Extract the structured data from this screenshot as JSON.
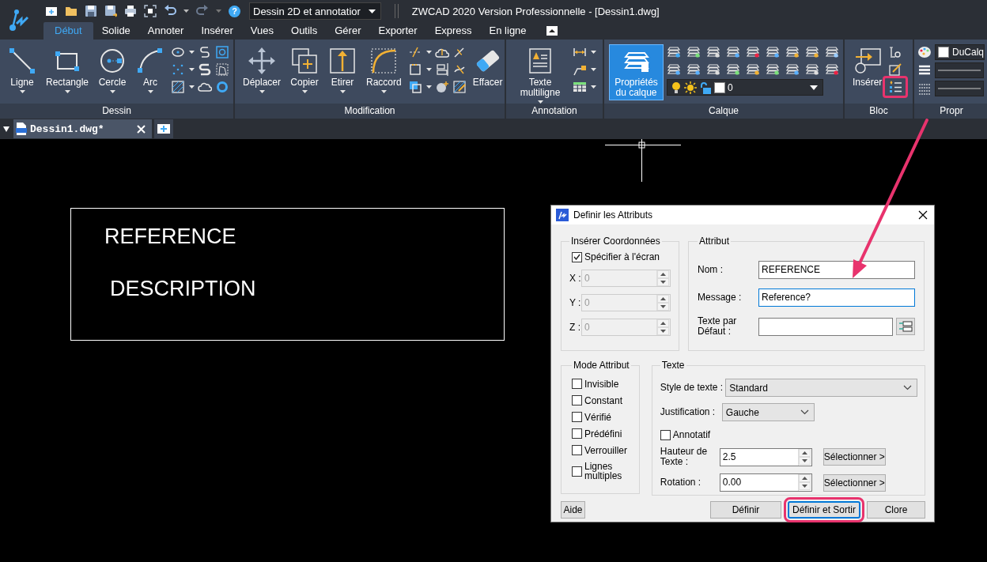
{
  "app": {
    "workspace": "Dessin 2D et annotatior",
    "title": "ZWCAD 2020 Version Professionnelle - [Dessin1.dwg]",
    "help": "?"
  },
  "ribbon_tabs": [
    {
      "label": "Début",
      "selected": true
    },
    {
      "label": "Solide",
      "selected": false
    },
    {
      "label": "Annoter",
      "selected": false
    },
    {
      "label": "Insérer",
      "selected": false
    },
    {
      "label": "Vues",
      "selected": false
    },
    {
      "label": "Outils",
      "selected": false
    },
    {
      "label": "Gérer",
      "selected": false
    },
    {
      "label": "Exporter",
      "selected": false
    },
    {
      "label": "Express",
      "selected": false
    },
    {
      "label": "En ligne",
      "selected": false
    }
  ],
  "ribbon_panels": [
    {
      "title": "Dessin",
      "tools": [
        {
          "label": "Ligne",
          "dropdown": true,
          "active": false
        },
        {
          "label": "Rectangle",
          "dropdown": true,
          "active": false
        },
        {
          "label": "Cercle",
          "dropdown": true,
          "active": false
        },
        {
          "label": "Arc",
          "dropdown": true,
          "active": false
        }
      ]
    },
    {
      "title": "Modification",
      "tools": [
        {
          "label": "Déplacer",
          "dropdown": true,
          "active": false
        },
        {
          "label": "Copier",
          "dropdown": true,
          "active": false
        },
        {
          "label": "Etirer",
          "dropdown": true,
          "active": false
        },
        {
          "label": "Raccord",
          "dropdown": true,
          "active": false
        },
        {
          "label": "Effacer",
          "dropdown": false,
          "active": false
        }
      ]
    },
    {
      "title": "Annotation",
      "tools": [
        {
          "label": "Texte multiligne",
          "dropdown": true,
          "active": false
        }
      ]
    },
    {
      "title": "Calque",
      "tools": [
        {
          "label": "Propriétés du calque",
          "dropdown": false,
          "active": true
        }
      ],
      "layer": "0"
    },
    {
      "title": "Bloc",
      "tools": [
        {
          "label": "Insérer",
          "dropdown": false,
          "active": false
        }
      ],
      "small_tools": [
        {
          "highlighted": false
        },
        {
          "highlighted": false
        },
        {
          "highlighted": true
        }
      ]
    },
    {
      "title": "Propr",
      "properties": [
        {
          "kind": "color",
          "value": "DuCalq"
        },
        {
          "kind": "line"
        },
        {
          "kind": "line"
        }
      ]
    }
  ],
  "doc_tabs": [
    {
      "label": "Dessin1.dwg*",
      "selected": true
    }
  ],
  "drawing": {
    "texts": [
      "REFERENCE",
      "DESCRIPTION"
    ]
  },
  "dialog": {
    "title": "Definir les Attributs",
    "insert_group": {
      "title": "Insérer Coordonnées",
      "on_screen": {
        "label": "Spécifier à l'écran",
        "checked": true
      },
      "coords": [
        {
          "label": "X :",
          "value": "0",
          "disabled": true
        },
        {
          "label": "Y :",
          "value": "0",
          "disabled": true
        },
        {
          "label": "Z :",
          "value": "0",
          "disabled": true
        }
      ]
    },
    "attribute_group": {
      "title": "Attribut",
      "fields": [
        {
          "label": "Nom :",
          "value": "REFERENCE",
          "focused": false
        },
        {
          "label": "Message :",
          "value": "Reference?",
          "focused": true
        },
        {
          "label": "Texte par Défaut :",
          "focused": false
        }
      ]
    },
    "mode_group": {
      "title": "Mode Attribut",
      "options": [
        {
          "label": "Invisible",
          "checked": false
        },
        {
          "label": "Constant",
          "checked": false
        },
        {
          "label": "Vérifié",
          "checked": false
        },
        {
          "label": "Prédéfini",
          "checked": false
        },
        {
          "label": "Verrouiller",
          "checked": false
        },
        {
          "label": "Lignes multiples",
          "checked": false
        }
      ]
    },
    "text_group": {
      "title": "Texte",
      "style": {
        "label": "Style de texte :",
        "value": "Standard"
      },
      "justification": {
        "label": "Justification :",
        "value": "Gauche"
      },
      "annotative": {
        "label": "Annotatif",
        "checked": false
      },
      "height": {
        "label": "Hauteur de Texte :",
        "value": "2.5",
        "button": "Sélectionner >"
      },
      "rotation": {
        "label": "Rotation :",
        "value": "0.00",
        "button": "Sélectionner >"
      }
    },
    "buttons": [
      {
        "label": "Aide",
        "highlighted": false
      },
      {
        "label": "Définir",
        "highlighted": false
      },
      {
        "label": "Définir et Sortir",
        "highlighted": true
      },
      {
        "label": "Clore",
        "highlighted": false
      }
    ]
  }
}
